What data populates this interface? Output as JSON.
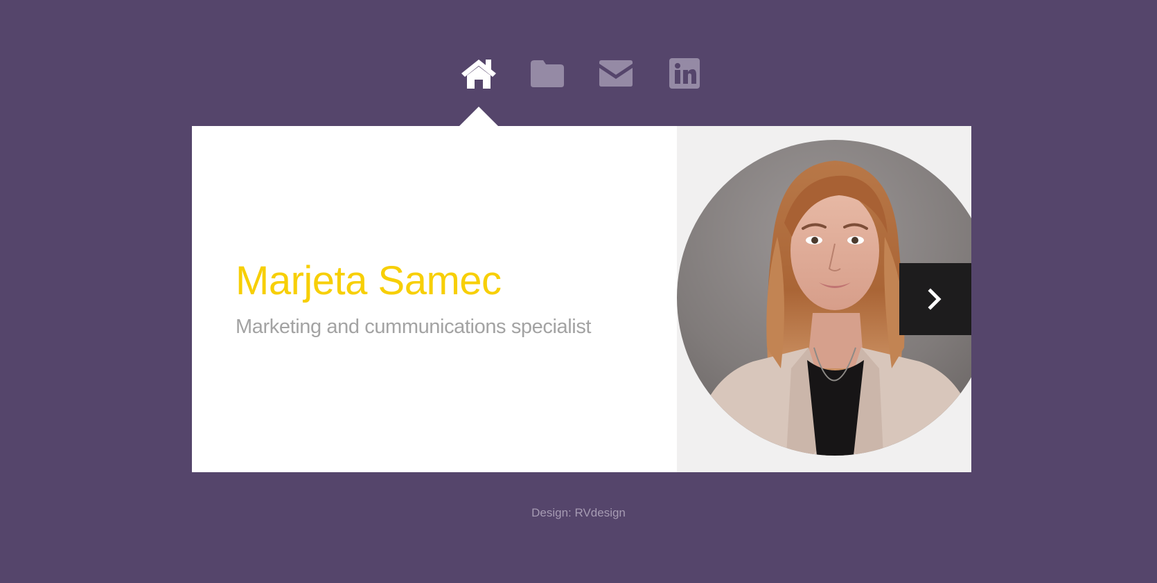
{
  "nav": {
    "items": [
      {
        "icon": "home-icon",
        "active": true
      },
      {
        "icon": "folder-icon",
        "active": false
      },
      {
        "icon": "mail-icon",
        "active": false
      },
      {
        "icon": "linkedin-icon",
        "active": false
      }
    ]
  },
  "profile": {
    "name": "Marjeta Samec",
    "title": "Marketing and cummunications specialist",
    "photo_icon": "portrait-photo"
  },
  "next_button": {
    "icon": "chevron-right-icon"
  },
  "footer": {
    "credit": "Design: RVdesign"
  },
  "colors": {
    "background": "#55456b",
    "name_accent": "#f7cf06",
    "subtitle": "#a3a3a3",
    "inactive_icon": "#958aa5",
    "active_icon": "#ffffff",
    "next_button_bg": "#1d1c1d"
  }
}
